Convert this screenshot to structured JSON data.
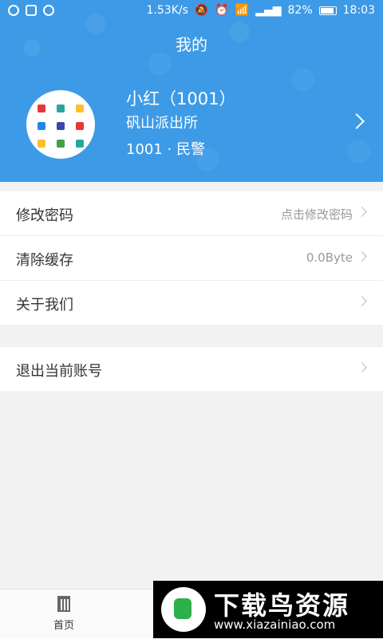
{
  "status_bar": {
    "speed": "1.53K/s",
    "battery": "82%",
    "time": "18:03"
  },
  "header": {
    "title": "我的",
    "user": {
      "name": "小红（1001）",
      "station": "矾山派出所",
      "role": "1001 · 民警"
    }
  },
  "settings": [
    {
      "label": "修改密码",
      "value": "点击修改密码"
    },
    {
      "label": "清除缓存",
      "value": "0.0Byte"
    },
    {
      "label": "关于我们",
      "value": ""
    }
  ],
  "logout": {
    "label": "退出当前账号"
  },
  "tabbar": {
    "home": "首页"
  },
  "watermark": {
    "title": "下载鸟资源",
    "url": "www.xiazainiao.com"
  },
  "colors": {
    "header_bg": "#3d9ae6",
    "accent": "#3d9ae6"
  }
}
